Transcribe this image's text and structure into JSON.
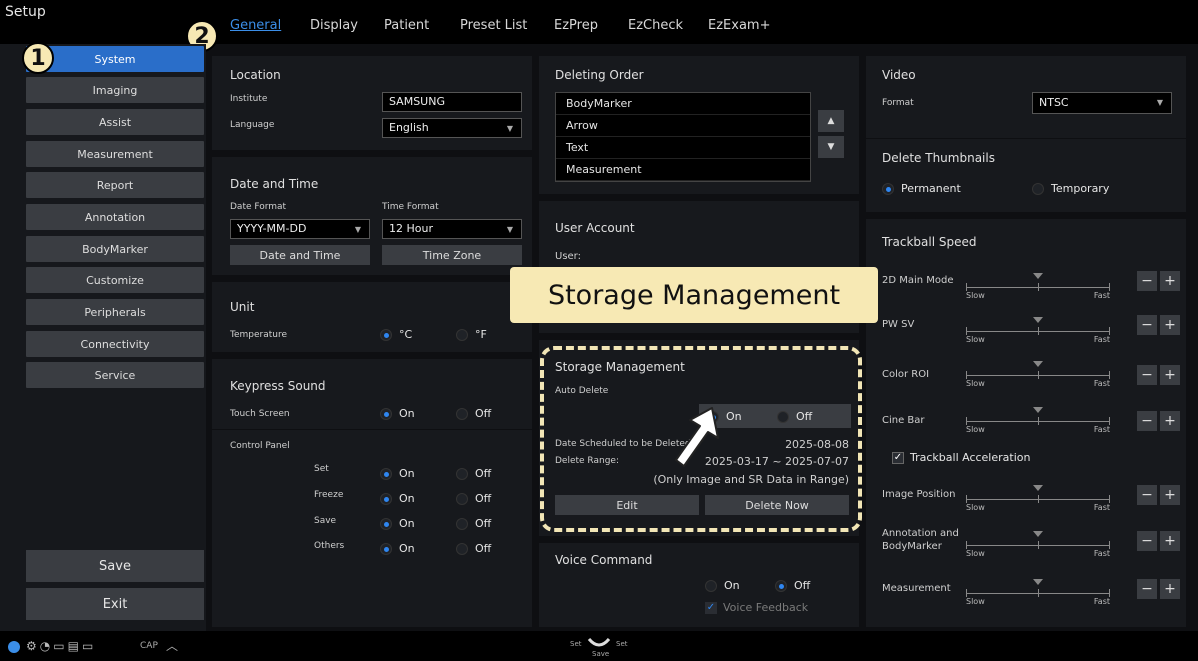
{
  "header": {
    "title": "Setup",
    "tabs": [
      "General",
      "Display",
      "Patient",
      "Preset List",
      "EzPrep",
      "EzCheck",
      "EzExam+"
    ]
  },
  "badges": {
    "one": "1",
    "two": "2"
  },
  "sidebar": {
    "items": [
      "System",
      "Imaging",
      "Assist",
      "Measurement",
      "Report",
      "Annotation",
      "BodyMarker",
      "Customize",
      "Peripherals",
      "Connectivity",
      "Service"
    ],
    "save": "Save",
    "exit": "Exit"
  },
  "location": {
    "title": "Location",
    "institute_label": "Institute",
    "institute_value": "SAMSUNG",
    "language_label": "Language",
    "language_value": "English"
  },
  "datetime": {
    "title": "Date and Time",
    "date_format_label": "Date Format",
    "date_format_value": "YYYY-MM-DD",
    "time_format_label": "Time Format",
    "time_format_value": "12 Hour",
    "date_time_button": "Date and Time",
    "time_zone_button": "Time Zone"
  },
  "unit": {
    "title": "Unit",
    "temperature_label": "Temperature",
    "celsius": "°C",
    "fahrenheit": "°F"
  },
  "keypress": {
    "title": "Keypress Sound",
    "touch_screen": "Touch Screen",
    "control_panel": "Control Panel",
    "rows": [
      "Set",
      "Freeze",
      "Save",
      "Others"
    ],
    "on": "On",
    "off": "Off"
  },
  "deleting_order": {
    "title": "Deleting Order",
    "items": [
      "BodyMarker",
      "Arrow",
      "Text",
      "Measurement"
    ]
  },
  "user_account": {
    "title": "User Account",
    "user_label": "User:"
  },
  "callout": {
    "text": "Storage Management"
  },
  "storage": {
    "title": "Storage Management",
    "auto_delete": "Auto Delete",
    "on": "On",
    "off": "Off",
    "scheduled_label": "Date Scheduled to be Deleted:",
    "scheduled_value": "2025-08-08",
    "range_label": "Delete Range:",
    "range_value": "2025-03-17 ~ 2025-07-07",
    "range_note": "(Only Image and SR Data in Range)",
    "edit": "Edit",
    "delete_now": "Delete Now"
  },
  "voice": {
    "title": "Voice Command",
    "on": "On",
    "off": "Off",
    "feedback": "Voice Feedback"
  },
  "video": {
    "title": "Video",
    "format_label": "Format",
    "format_value": "NTSC"
  },
  "thumbnails": {
    "title": "Delete Thumbnails",
    "permanent": "Permanent",
    "temporary": "Temporary"
  },
  "trackball": {
    "title": "Trackball Speed",
    "rows": [
      "2D Main Mode",
      "PW SV",
      "Color ROI",
      "Cine Bar",
      "Image Position",
      "Annotation and BodyMarker",
      "Measurement"
    ],
    "slow": "Slow",
    "fast": "Fast",
    "acceleration": "Trackball Acceleration",
    "minus": "−",
    "plus": "+"
  },
  "status": {
    "cap": "CAP",
    "set_left": "Set",
    "set_right": "Set",
    "save": "Save"
  },
  "colors": {
    "accent": "#2f86f0",
    "selected_tab": "#3b8ee8",
    "callout_bg": "#f7e9b4",
    "highlight_dash": "#f2e6b6"
  }
}
